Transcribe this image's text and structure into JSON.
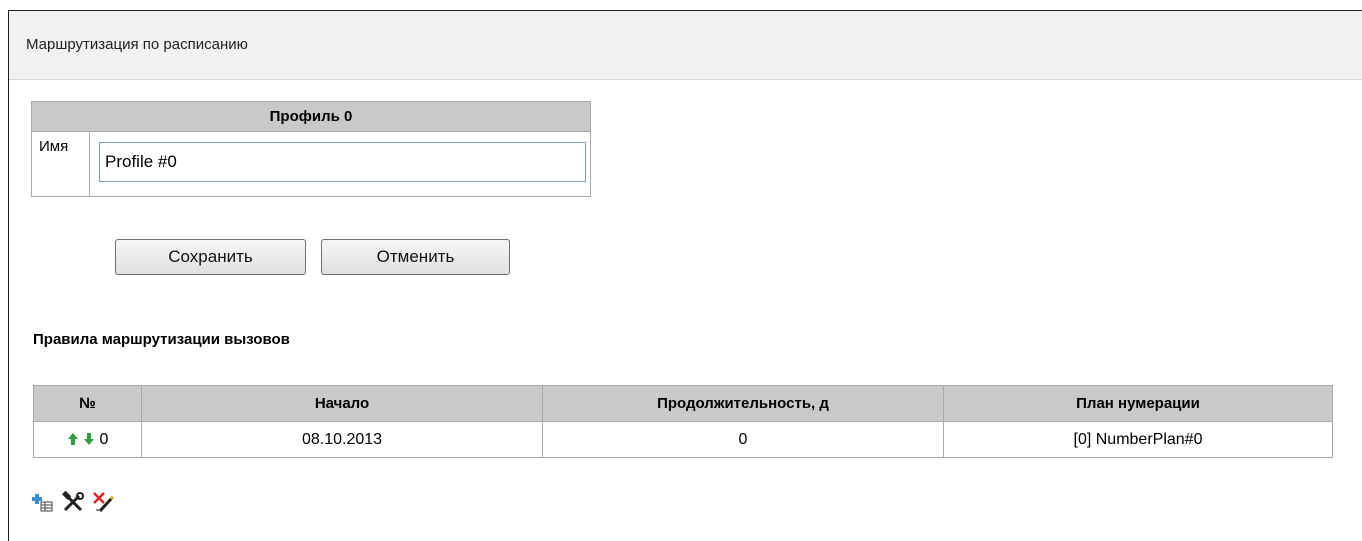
{
  "header": {
    "title": "Маршрутизация по расписанию"
  },
  "profile": {
    "title": "Профиль 0",
    "name_label": "Имя",
    "name_value": "Profile #0"
  },
  "buttons": {
    "save": "Сохранить",
    "cancel": "Отменить"
  },
  "rules": {
    "title": "Правила маршрутизации вызовов",
    "columns": [
      "№",
      "Начало",
      "Продолжительность, д",
      "План нумерации"
    ],
    "rows": [
      {
        "number": "0",
        "start": "08.10.2013",
        "duration": "0",
        "plan": "[0] NumberPlan#0"
      }
    ]
  },
  "toolbar": {
    "icons": [
      "add-rule-icon",
      "edit-rule-icon",
      "delete-rule-icon"
    ]
  },
  "colors": {
    "header_bg": "#c9c9c9",
    "arrow_green": "#2e9e3a",
    "add_blue": "#3a8fd0",
    "delete_red": "#d22"
  }
}
